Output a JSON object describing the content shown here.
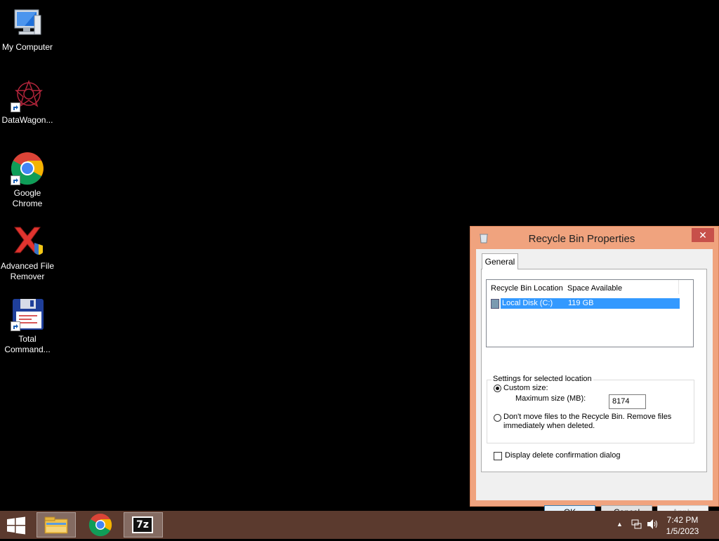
{
  "desktop": {
    "icons": [
      {
        "label": "My Computer",
        "icon": "computer-icon"
      },
      {
        "label": "DataWagon...",
        "icon": "datawagon-icon"
      },
      {
        "label": "Google Chrome",
        "line1": "Google",
        "line2": "Chrome",
        "icon": "chrome-icon"
      },
      {
        "label": "Advanced File Remover",
        "line1": "Advanced File",
        "line2": "Remover",
        "icon": "file-remover-icon"
      },
      {
        "label": "Total Command...",
        "line1": "Total",
        "line2": "Command...",
        "icon": "total-commander-icon"
      }
    ]
  },
  "dialog": {
    "title": "Recycle Bin Properties",
    "close_label": "✕",
    "tab": "General",
    "list": {
      "col1": "Recycle Bin Location",
      "col2": "Space Available",
      "rows": [
        {
          "location": "Local Disk (C:)",
          "space": "119 GB"
        }
      ]
    },
    "settings": {
      "legend": "Settings for selected location",
      "custom_label": "Custom size:",
      "max_label": "Maximum size (MB):",
      "max_value": "8174",
      "dont_move_line1": "Don't move files to the Recycle Bin. Remove files",
      "dont_move_line2": "immediately when deleted."
    },
    "confirm_label": "Display delete confirmation dialog",
    "buttons": {
      "ok": "OK",
      "cancel": "Cancel",
      "apply": "Apply"
    }
  },
  "taskbar": {
    "pinned": [
      "file-explorer-icon",
      "chrome-icon",
      "7zip-icon"
    ],
    "seven_zip_label": "7z",
    "time": "7:42 PM",
    "date": "1/5/2023"
  }
}
